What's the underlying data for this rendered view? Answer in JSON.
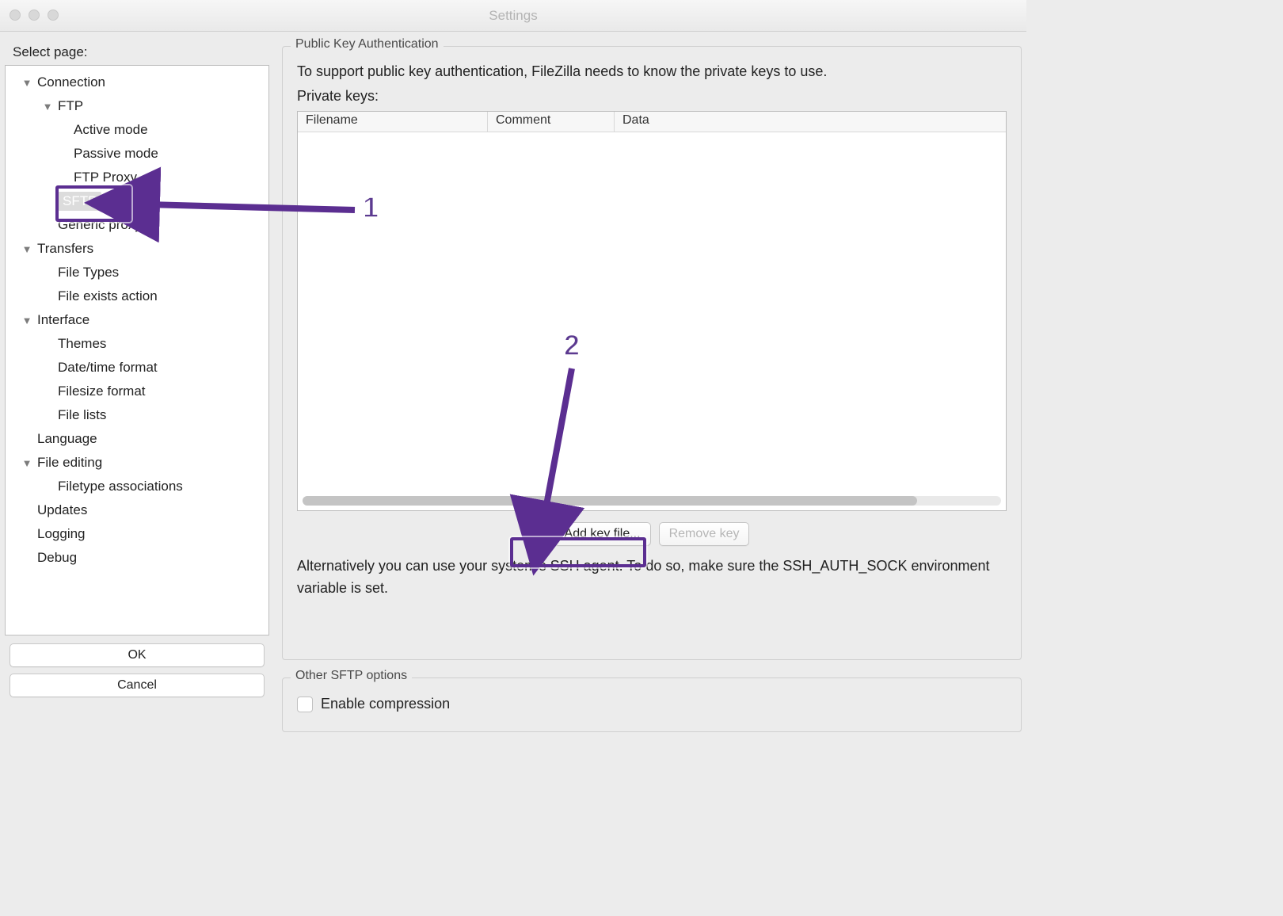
{
  "window": {
    "title": "Settings"
  },
  "sidebar": {
    "label": "Select page:",
    "items": [
      {
        "label": "Connection",
        "level": 1,
        "expandable": true
      },
      {
        "label": "FTP",
        "level": 2,
        "expandable": true
      },
      {
        "label": "Active mode",
        "level": 3,
        "expandable": false
      },
      {
        "label": "Passive mode",
        "level": 3,
        "expandable": false
      },
      {
        "label": "FTP Proxy",
        "level": 3,
        "expandable": false
      },
      {
        "label": "SFTP",
        "level": 2,
        "expandable": false,
        "selected": true
      },
      {
        "label": "Generic proxy",
        "level": 2,
        "expandable": false
      },
      {
        "label": "Transfers",
        "level": 1,
        "expandable": true
      },
      {
        "label": "File Types",
        "level": 2,
        "expandable": false
      },
      {
        "label": "File exists action",
        "level": 2,
        "expandable": false
      },
      {
        "label": "Interface",
        "level": 1,
        "expandable": true
      },
      {
        "label": "Themes",
        "level": 2,
        "expandable": false
      },
      {
        "label": "Date/time format",
        "level": 2,
        "expandable": false
      },
      {
        "label": "Filesize format",
        "level": 2,
        "expandable": false
      },
      {
        "label": "File lists",
        "level": 2,
        "expandable": false
      },
      {
        "label": "Language",
        "level": 1,
        "expandable": false
      },
      {
        "label": "File editing",
        "level": 1,
        "expandable": true
      },
      {
        "label": "Filetype associations",
        "level": 2,
        "expandable": false
      },
      {
        "label": "Updates",
        "level": 1,
        "expandable": false
      },
      {
        "label": "Logging",
        "level": 1,
        "expandable": false
      },
      {
        "label": "Debug",
        "level": 1,
        "expandable": false
      }
    ],
    "ok": "OK",
    "cancel": "Cancel"
  },
  "panel": {
    "group_title": "Public Key Authentication",
    "desc": "To support public key authentication, FileZilla needs to know the private keys to use.",
    "subhead": "Private keys:",
    "columns": {
      "filename": "Filename",
      "comment": "Comment",
      "data": "Data"
    },
    "add_key": "Add key file...",
    "remove_key": "Remove key",
    "note": "Alternatively you can use your system's SSH agent. To do so, make sure the SSH_AUTH_SOCK environment variable is set.",
    "other_group": "Other SFTP options",
    "enable_compression": "Enable compression"
  },
  "annotations": {
    "one": "1",
    "two": "2"
  }
}
